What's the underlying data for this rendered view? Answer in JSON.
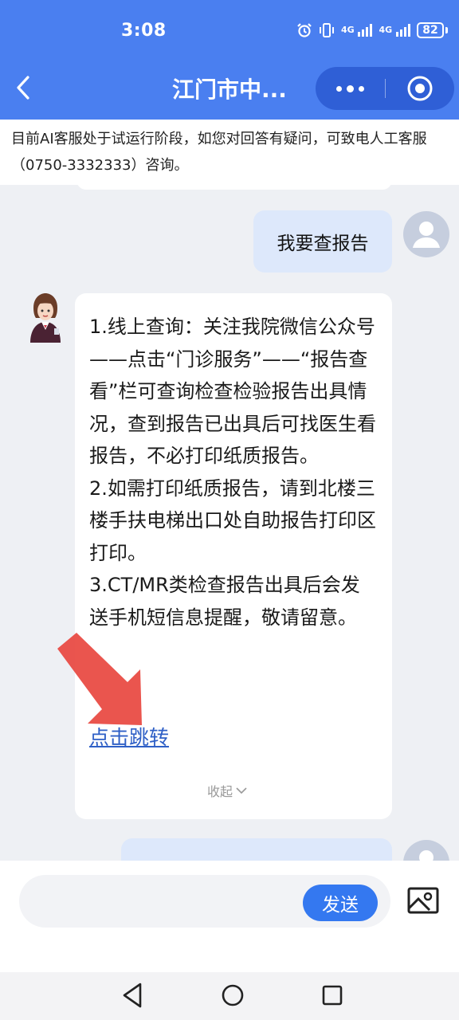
{
  "status_bar": {
    "time": "3:08",
    "battery": "82",
    "net1": "4G",
    "net2": "4G"
  },
  "title_bar": {
    "title": "江门市中..."
  },
  "notice": {
    "text": "目前AI客服处于试运行阶段，如您对回答有疑问，可致电人工客服（0750-3332333）咨询。"
  },
  "chat": {
    "user_message": "我要查报告",
    "bot_reply": {
      "lines": [
        "1.线上查询：关注我院微信公众号——点击“门诊服务”——“报告查看”栏可查询检查检验报告出具情况，查到报告已出具后可找医生看报告，不必打印纸质报告。",
        "2.如需打印纸质报告，请到北楼三楼手扶电梯出口处自助报告打印区打印。",
        "3.CT/MR类检查报告出具后会发送手机短信息提醒，敬请留意。"
      ],
      "link_text": "点击跳转",
      "collapse_text": "收起"
    }
  },
  "input": {
    "send_label": "发送"
  },
  "colors": {
    "header_bg": "#4a7ff0",
    "user_bubble": "#dde8fb",
    "link": "#2e5fc6",
    "send_button": "#3478f0",
    "annotation_arrow": "#e8473f"
  }
}
